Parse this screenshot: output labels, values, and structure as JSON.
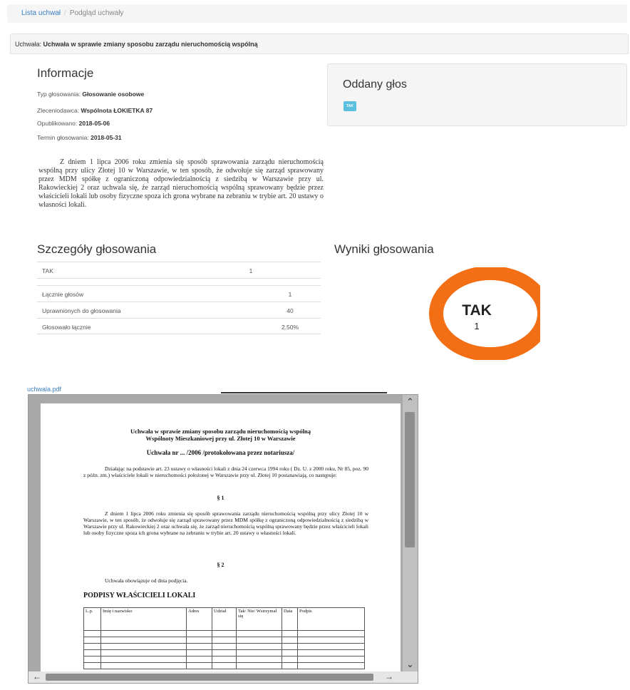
{
  "breadcrumb": {
    "list_link": "Lista uchwał",
    "current": "Podgląd uchwały"
  },
  "header": {
    "label": "Uchwała:",
    "title": "Uchwała w sprawie zmiany sposobu zarządu nieruchomością wspólną"
  },
  "info": {
    "title": "Informacje",
    "type_label": "Typ głosowania:",
    "type_value": "Głosowanie osobowe",
    "client_label": "Zleceniodawca:",
    "client_value": "Wspólnota ŁOKIETKA 87",
    "published_label": "Opublikowano:",
    "published_value": "2018-05-06",
    "deadline_label": "Termin głosowania:",
    "deadline_value": "2018-05-31",
    "description": "Z dniem 1 lipca 2006 roku zmienia się sposób sprawowania zarządu nieruchomością wspólną przy ulicy Złotej 10 w Warszawie, w ten sposób, że odwołuje się zarząd sprawowany przez MDM spółkę z ograniczoną odpowiedzialnością z siedzibą w Warszawie przy ul. Rakowieckiej 2 oraz uchwala się, że zarząd nieruchomością wspólną sprawowany będzie przez właścicieli lokali lub osoby fizyczne spoza ich grona wybrane na zebraniu w trybie art. 20 ustawy o własności lokali."
  },
  "vote": {
    "title": "Oddany głos",
    "badge": "TAK",
    "badge_color": "#5bc0de"
  },
  "details": {
    "title": "Szczegóły głosowania",
    "answer_label": "TAK",
    "answer_value": "1",
    "total_label": "Łącznie głosów",
    "total_value": "1",
    "eligible_label": "Uprawnionych do głosowania",
    "eligible_value": "40",
    "turnout_label": "Głosowało łącznie",
    "turnout_value": "2.50%"
  },
  "results": {
    "title": "Wyniki głosowania",
    "center_label": "TAK",
    "center_value": "1",
    "donut_color": "#f36f16",
    "share": 1.0
  },
  "pdf": {
    "link": "uchwala.pdf",
    "title_line1": "Uchwała w sprawie zmiany sposobu zarządu nieruchomością wspólną",
    "title_line2": "Wspólnoty Mieszkaniowej przy ul. Złotej 10 w Warszawie",
    "subtitle": "Uchwała nr ... /2006 /protokołowana przez notariusza/",
    "para1": "Działając na podstawie art. 23 ustawy o własności lokali z dnia 24 czerwca 1994 roku ( Dz. U. z 2000 roku, Nr 85, poz. 90 z późn. zm.) właściciele lokali w nieruchomości położonej w Warszawie przy ul. Złotej 10 postanawiają, co następuje:",
    "section1": "§ 1",
    "para2": "Z dniem 1 lipca 2006 roku zmienia się sposób sprawowania zarządu nieruchomością wspólną przy ulicy Złotej 10 w Warszawie, w ten sposób, że odwołuje się zarząd sprawowany przez MDM spółkę z ograniczoną odpowiedzialnością z siedzibą w Warszawie przy ul. Rakowieckiej 2 oraz uchwala się, że zarząd nieruchomością wspólną sprawowany będzie przez właścicieli lokali lub osoby fizyczne spoza ich grona wybrane na zebraniu w trybie art. 20 ustawy o własności lokali.",
    "section2": "§ 2",
    "para3": "Uchwała obowiązuje od dnia podjęcia.",
    "signatures_title": "PODPISY WŁAŚCICIELI LOKALI",
    "table_headers": [
      "L.p.",
      "Imię i nazwisko",
      "Adres",
      "Udział",
      "Tak/ Nie/ Wstrzymał się",
      "Data",
      "Podpis"
    ]
  }
}
